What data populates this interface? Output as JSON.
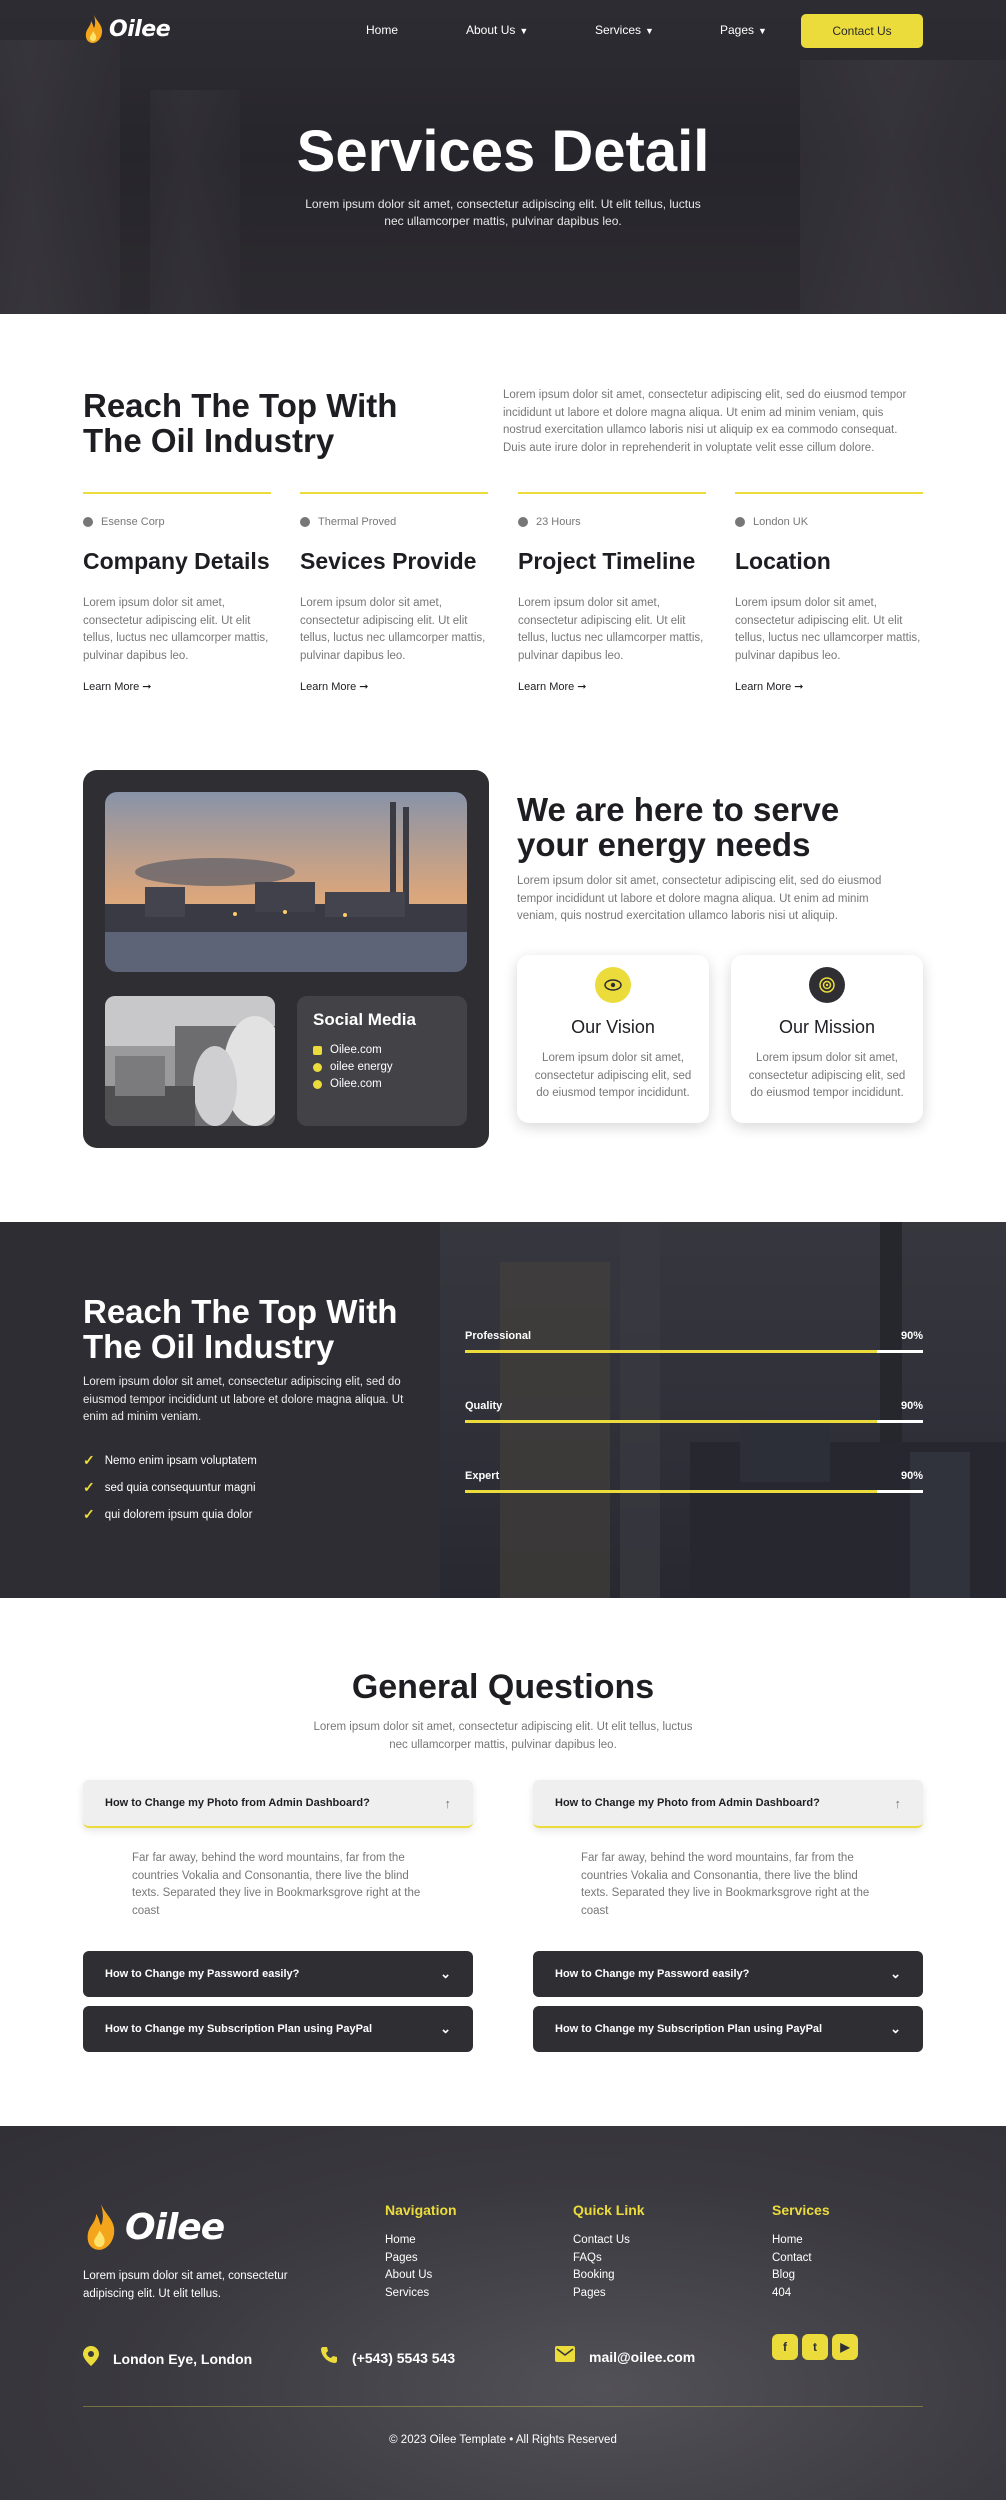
{
  "brand": {
    "name": "Oilee",
    "accent": "#ecdc3b",
    "dark": "#2f2e33"
  },
  "nav": {
    "items": [
      {
        "label": "Home",
        "has_dropdown": false
      },
      {
        "label": "About Us",
        "has_dropdown": true
      },
      {
        "label": "Services",
        "has_dropdown": true
      },
      {
        "label": "Pages",
        "has_dropdown": true
      }
    ],
    "cta": "Contact Us",
    "chevron": "chevron-down-icon"
  },
  "hero": {
    "title": "Services Detail",
    "subtitle": "Lorem ipsum dolor sit amet, consectetur adipiscing elit. Ut elit tellus, luctus nec ullamcorper mattis, pulvinar dapibus leo."
  },
  "intro": {
    "title": "Reach The Top With The Oil Industry",
    "text": "Lorem ipsum dolor sit amet, consectetur adipiscing elit, sed do eiusmod tempor incididunt ut labore et dolore magna aliqua. Ut enim ad minim veniam, quis nostrud exercitation ullamco laboris nisi ut aliquip ex ea commodo consequat. Duis aute irure dolor in reprehenderit in voluptate velit esse cillum dolore."
  },
  "features": [
    {
      "tag": "Esense Corp",
      "title": "Company Details",
      "text": "Lorem ipsum dolor sit amet, consectetur adipiscing elit. Ut elit tellus, luctus nec ullamcorper mattis, pulvinar dapibus leo.",
      "link": "Learn More ➞"
    },
    {
      "tag": "Thermal Proved",
      "title": "Sevices Provide",
      "text": "Lorem ipsum dolor sit amet, consectetur adipiscing elit. Ut elit tellus, luctus nec ullamcorper mattis, pulvinar dapibus leo.",
      "link": "Learn More ➞"
    },
    {
      "tag": "23 Hours",
      "title": "Project Timeline",
      "text": "Lorem ipsum dolor sit amet, consectetur adipiscing elit. Ut elit tellus, luctus nec ullamcorper mattis, pulvinar dapibus leo.",
      "link": "Learn More ➞"
    },
    {
      "tag": "London UK",
      "title": "Location",
      "text": "Lorem ipsum dolor sit amet, consectetur adipiscing elit. Ut elit tellus, luctus nec ullamcorper mattis, pulvinar dapibus leo.",
      "link": "Learn More ➞"
    }
  ],
  "energy": {
    "title": "We are here to serve your energy needs",
    "text": "Lorem ipsum dolor sit amet, consectetur adipiscing elit, sed do eiusmod tempor incididunt ut labore et dolore magna aliqua. Ut enim ad minim veniam, quis nostrud exercitation ullamco laboris nisi ut aliquip.",
    "social": {
      "title": "Social Media",
      "items": [
        "Oilee.com",
        "oilee energy",
        "Oilee.com"
      ]
    },
    "cards": [
      {
        "title": "Our Vision",
        "icon": "eye-icon",
        "text": "Lorem ipsum dolor sit amet, consectetur adipiscing elit, sed do eiusmod tempor incididunt."
      },
      {
        "title": "Our Mission",
        "icon": "target-icon",
        "text": "Lorem ipsum dolor sit amet, consectetur adipiscing elit, sed do eiusmod tempor incididunt."
      }
    ]
  },
  "skills": {
    "title": "Reach The Top With The Oil Industry",
    "text": "Lorem ipsum dolor sit amet, consectetur adipiscing elit, sed do eiusmod tempor incididunt ut labore et dolore magna aliqua. Ut enim ad minim veniam.",
    "checks": [
      "Nemo enim ipsam voluptatem",
      "sed quia consequuntur magni",
      "qui dolorem ipsum quia dolor"
    ],
    "bars": [
      {
        "label": "Professional",
        "value": "90%",
        "fill": 0.9
      },
      {
        "label": "Quality",
        "value": "90%",
        "fill": 0.9
      },
      {
        "label": "Expert",
        "value": "90%",
        "fill": 0.9
      }
    ]
  },
  "faq": {
    "title": "General Questions",
    "subtitle": "Lorem ipsum dolor sit amet, consectetur adipiscing elit. Ut elit tellus, luctus nec ullamcorper mattis, pulvinar dapibus leo.",
    "open_question": "How to Change my Photo from Admin Dashboard?",
    "answer": "Far far away, behind the word mountains, far from the countries Vokalia and Consonantia, there live the blind texts. Separated they live in Bookmarksgrove right at the coast",
    "q_password": "How to Change my Password easily?",
    "q_subscription": "How to Change my Subscription Plan using PayPal"
  },
  "footer": {
    "description": "Lorem ipsum dolor sit amet, consectetur adipiscing elit. Ut elit tellus.",
    "columns": [
      {
        "title": "Navigation",
        "links": [
          "Home",
          "Pages",
          "About Us",
          "Services"
        ]
      },
      {
        "title": "Quick Link",
        "links": [
          "Contact Us",
          "FAQs",
          "Booking",
          "Pages"
        ]
      },
      {
        "title": "Services",
        "links": [
          "Home",
          "Contact",
          "Blog",
          "404"
        ]
      }
    ],
    "address": "London Eye, London",
    "phone": "(+543) 5543 543",
    "email": "mail@oilee.com",
    "socials": [
      "facebook-icon",
      "twitter-icon",
      "youtube-icon"
    ],
    "copyright": "© 2023 Oilee Template • All Rights Reserved"
  }
}
